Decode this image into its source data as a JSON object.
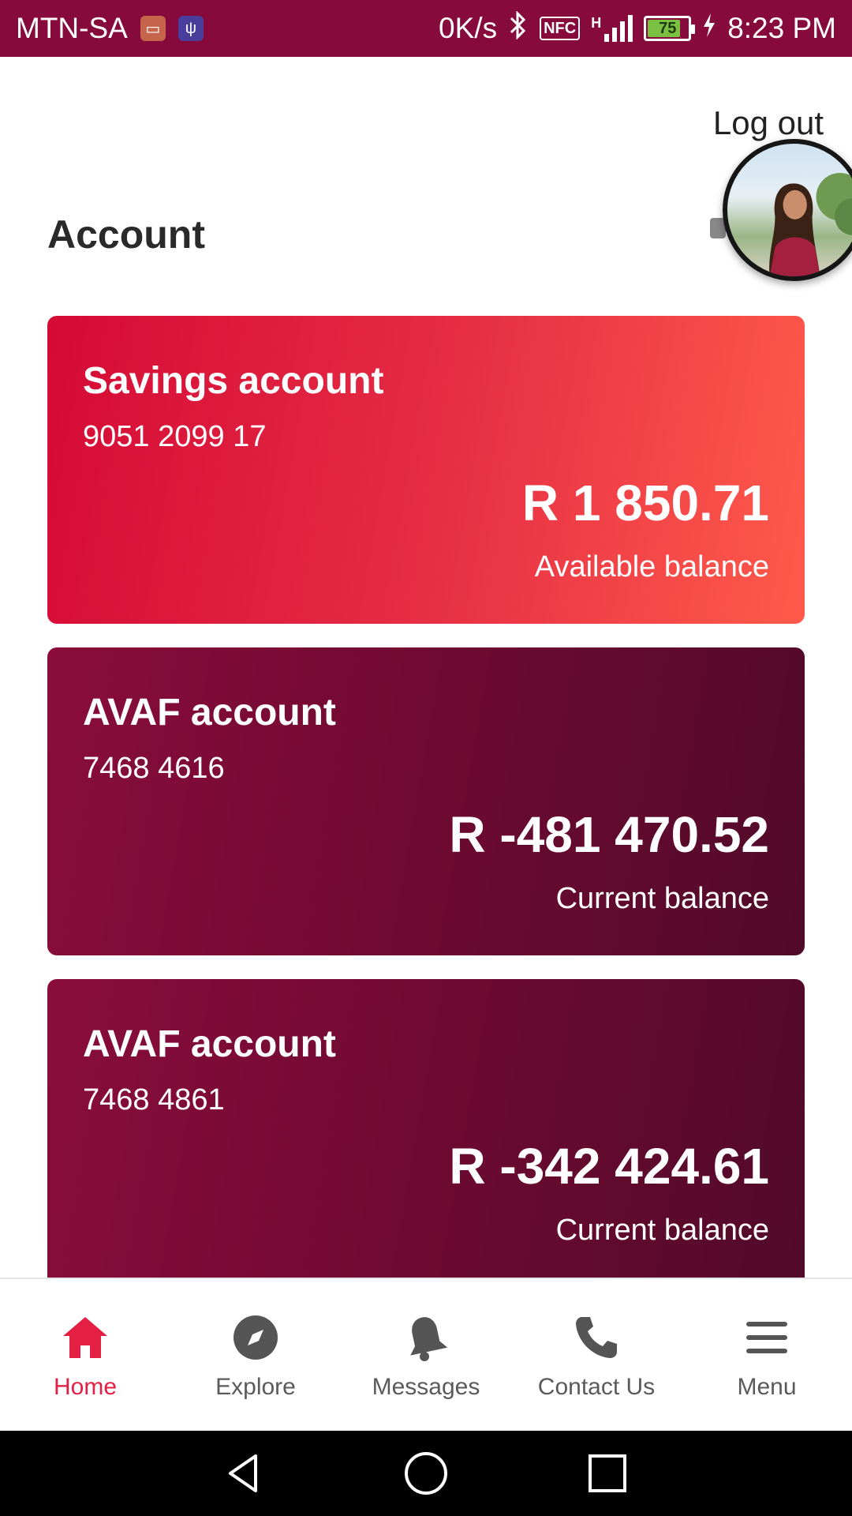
{
  "status_bar": {
    "carrier": "MTN-SA",
    "speed": "0K/s",
    "nfc": "NFC",
    "network": "H",
    "battery": "75",
    "battery_level": 0.75,
    "time": "8:23 PM",
    "icons": [
      "inbox-icon",
      "usb-icon",
      "bluetooth-icon",
      "nfc-icon",
      "signal-icon",
      "battery-icon",
      "charging-icon"
    ]
  },
  "header": {
    "logout_label": "Log out",
    "title": "Account"
  },
  "accounts": [
    {
      "name": "Savings account",
      "number": "9051 2099 17",
      "amount": "R 1 850.71",
      "balance_label": "Available balance"
    },
    {
      "name": "AVAF account",
      "number": "7468 4616",
      "amount": "R -481 470.52",
      "balance_label": "Current balance"
    },
    {
      "name": "AVAF account",
      "number": "7468 4861",
      "amount": "R -342 424.61",
      "balance_label": "Current balance"
    }
  ],
  "bottom_nav": {
    "items": [
      {
        "label": "Home",
        "icon": "home-icon",
        "active": true
      },
      {
        "label": "Explore",
        "icon": "compass-icon",
        "active": false
      },
      {
        "label": "Messages",
        "icon": "bell-icon",
        "active": false
      },
      {
        "label": "Contact Us",
        "icon": "phone-icon",
        "active": false
      },
      {
        "label": "Menu",
        "icon": "menu-icon",
        "active": false
      }
    ]
  },
  "colors": {
    "status_bar": "#870a3c",
    "accent": "#e31f44",
    "savings_card_start": "#d50a35",
    "savings_card_end": "#ff5a4a",
    "avaf_card_start": "#8a0c3b",
    "avaf_card_end": "#520a2a"
  }
}
